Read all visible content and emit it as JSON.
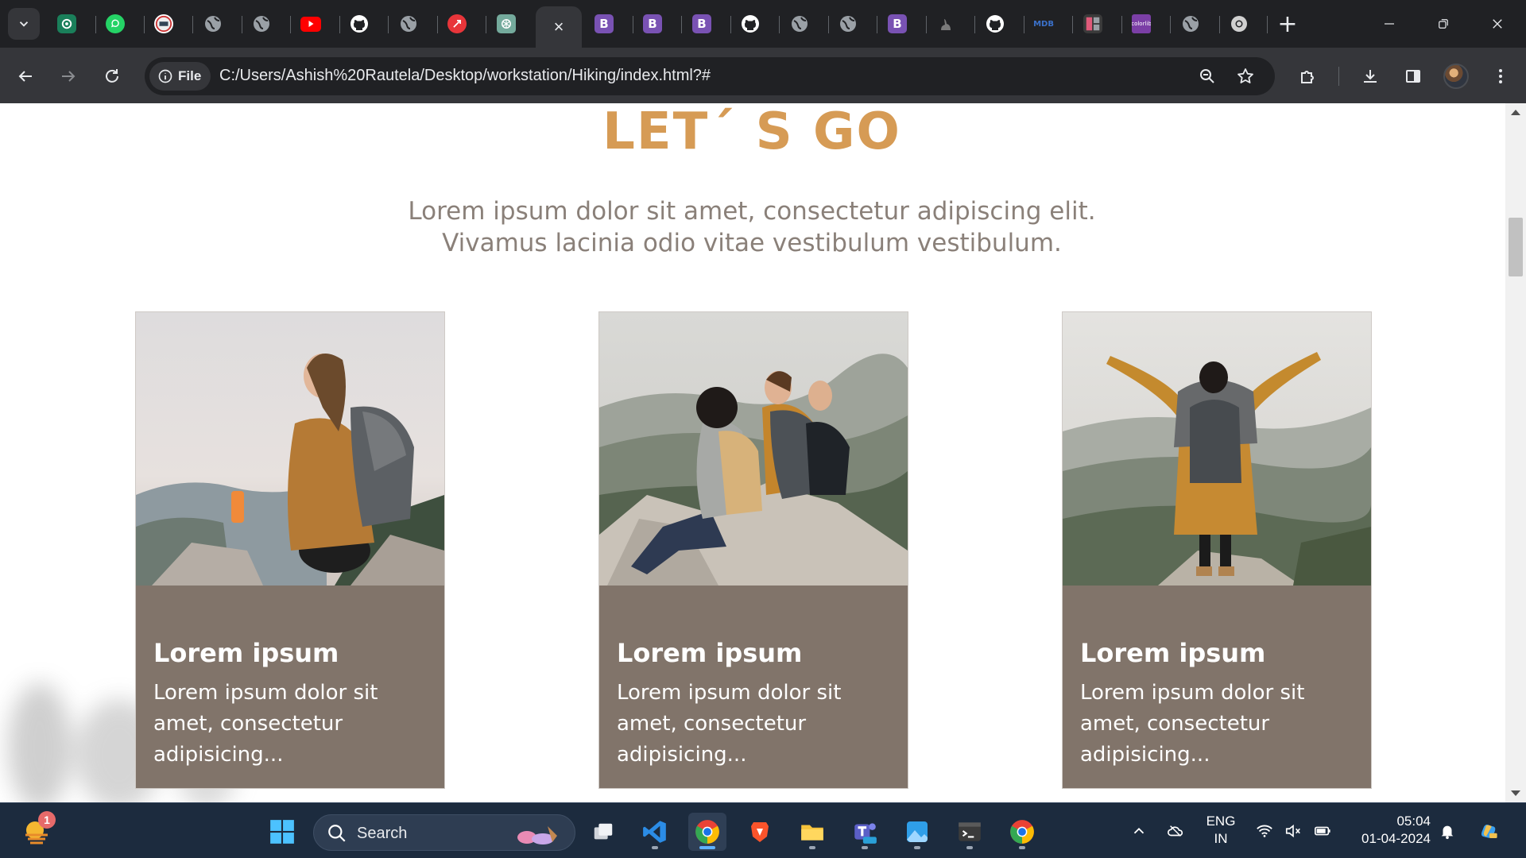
{
  "browser": {
    "tabs": [
      {
        "name": "tab-ad",
        "fav": "P",
        "color": "#1a7f5a"
      },
      {
        "name": "tab-whatsapp",
        "fav": "whatsapp-icon",
        "color": "#25d366"
      },
      {
        "name": "tab-site",
        "fav": "site-icon",
        "color": "#d8d8d8"
      },
      {
        "name": "tab-globe-1",
        "fav": "globe-icon",
        "color": "#9aa0a6"
      },
      {
        "name": "tab-globe-2",
        "fav": "globe-icon",
        "color": "#9aa0a6"
      },
      {
        "name": "tab-youtube",
        "fav": "youtube-icon",
        "color": "#ff0000"
      },
      {
        "name": "tab-github-1",
        "fav": "github-icon",
        "color": "#ffffff"
      },
      {
        "name": "tab-globe-3",
        "fav": "globe-icon",
        "color": "#9aa0a6"
      },
      {
        "name": "tab-app",
        "fav": "app-icon",
        "color": "#e8353a"
      },
      {
        "name": "tab-chatgpt",
        "fav": "chatgpt-icon",
        "color": "#74aa9c"
      }
    ],
    "tabs_right": [
      {
        "name": "tab-bootstrap-1",
        "fav": "B",
        "color": "#7952b3"
      },
      {
        "name": "tab-bootstrap-2",
        "fav": "B",
        "color": "#7952b3"
      },
      {
        "name": "tab-bootstrap-3",
        "fav": "B",
        "color": "#7952b3"
      },
      {
        "name": "tab-github-2",
        "fav": "github-icon",
        "color": "#ffffff"
      },
      {
        "name": "tab-globe-4",
        "fav": "globe-icon",
        "color": "#9aa0a6"
      },
      {
        "name": "tab-globe-5",
        "fav": "globe-icon",
        "color": "#9aa0a6"
      },
      {
        "name": "tab-bootstrap-4",
        "fav": "B",
        "color": "#7952b3"
      },
      {
        "name": "tab-rabbit",
        "fav": "rabbit-icon",
        "color": "#7a7a7a"
      },
      {
        "name": "tab-github-3",
        "fav": "github-icon",
        "color": "#ffffff"
      },
      {
        "name": "tab-mdb",
        "fav": "MDB",
        "color": "#3b71ca"
      },
      {
        "name": "tab-layout",
        "fav": "layout-icon",
        "color": "#e05a7a"
      },
      {
        "name": "tab-colorlib",
        "fav": "colorlib",
        "color": "#7b3fa6"
      },
      {
        "name": "tab-globe-6",
        "fav": "globe-icon",
        "color": "#9aa0a6"
      },
      {
        "name": "tab-chrome",
        "fav": "chrome-icon",
        "color": "#d0d0d0"
      }
    ],
    "active_tab_close": "×",
    "new_tab": "+",
    "file_chip": "File",
    "url": "C:/Users/Ashish%20Rautela/Desktop/workstation/Hiking/index.html?#"
  },
  "page": {
    "title": "LET´ S GO",
    "subtitle_line1": "Lorem ipsum dolor sit amet, consectetur adipiscing elit.",
    "subtitle_line2": "Vivamus lacinia odio vitae vestibulum vestibulum.",
    "cards": [
      {
        "title": "Lorem ipsum",
        "text": "Lorem ipsum dolor sit amet, consectetur adipisicing...",
        "image": "hiker-sitting-photo"
      },
      {
        "title": "Lorem ipsum",
        "text": "Lorem ipsum dolor sit amet, consectetur adipisicing...",
        "image": "hikers-group-photo"
      },
      {
        "title": "Lorem ipsum",
        "text": "Lorem ipsum dolor sit amet, consectetur adipisicing...",
        "image": "hiker-arms-raised-photo"
      }
    ],
    "colors": {
      "title": "#d69b55",
      "subtitle": "#8a8079",
      "card_bg": "#81746a"
    }
  },
  "taskbar": {
    "weather_badge": "1",
    "search_label": "Search",
    "lang_line1": "ENG",
    "lang_line2": "IN",
    "time": "05:04",
    "date": "01-04-2024"
  }
}
